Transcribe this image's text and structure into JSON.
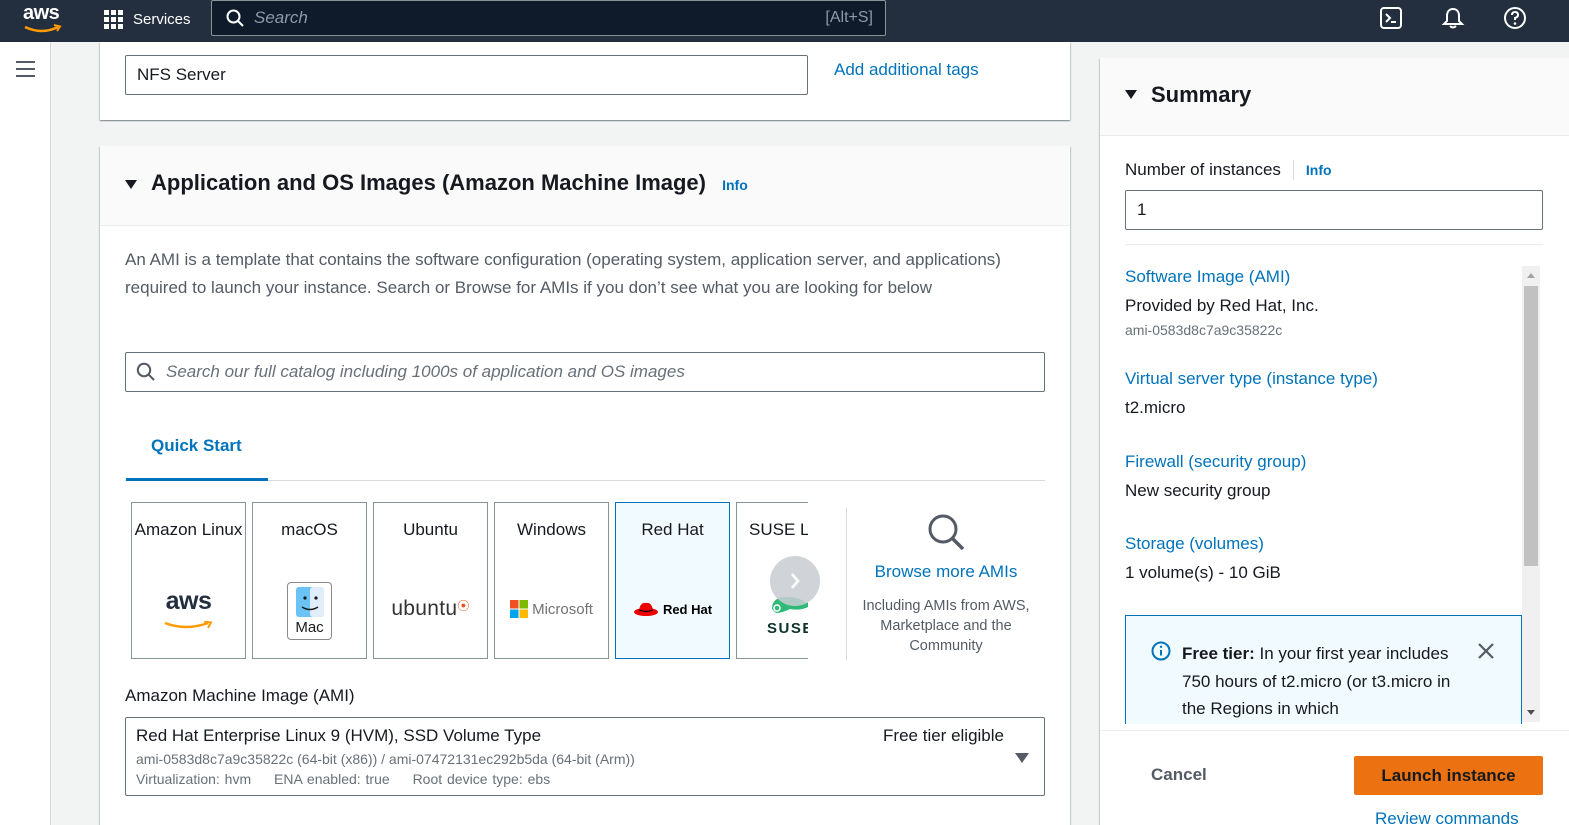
{
  "topnav": {
    "logo_text": "aws",
    "services_label": "Services",
    "search_placeholder": "Search",
    "search_shortcut": "[Alt+S]",
    "icons": [
      "cloudshell-icon",
      "notifications-bell-icon",
      "help-icon"
    ]
  },
  "name_section": {
    "name_value": "NFS Server",
    "add_tags_label": "Add additional tags"
  },
  "ami_section": {
    "title": "Application and OS Images (Amazon Machine Image)",
    "info_label": "Info",
    "description": "An AMI is a template that contains the software configuration (operating system, application server, and applications) required to launch your instance. Search or Browse for AMIs if you don’t see what you are looking for below",
    "catalog_search_placeholder": "Search our full catalog including 1000s of application and OS images",
    "tab_label": "Quick Start",
    "os_cards": [
      {
        "label": "Amazon Linux",
        "logo": "aws"
      },
      {
        "label": "macOS",
        "logo": "Mac"
      },
      {
        "label": "Ubuntu",
        "logo": "ubuntu"
      },
      {
        "label": "Windows",
        "logo": "Microsoft"
      },
      {
        "label": "Red Hat",
        "logo": "Red Hat",
        "selected": true
      },
      {
        "label": "SUSE Li",
        "logo": "SUSE"
      }
    ],
    "browse_title": "Browse more AMIs",
    "browse_subtitle": "Including AMIs from AWS, Marketplace and the Community",
    "ami_label": "Amazon Machine Image (AMI)",
    "ami_selected": {
      "name": "Red Hat Enterprise Linux 9 (HVM), SSD Volume Type",
      "badge": "Free tier eligible",
      "ids": "ami-0583d8c7a9c35822c (64-bit (x86)) / ami-07472131ec292b5da (64-bit (Arm))",
      "virtualization": "Virtualization: hvm",
      "ena": "ENA enabled: true",
      "root_device": "Root device type: ebs"
    }
  },
  "summary": {
    "title": "Summary",
    "num_instances_label": "Number of instances",
    "info_label": "Info",
    "num_instances_value": "1",
    "software_image_label": "Software Image (AMI)",
    "software_image_value": "Provided by Red Hat, Inc.",
    "software_image_id": "ami-0583d8c7a9c35822c",
    "instance_type_label": "Virtual server type (instance type)",
    "instance_type_value": "t2.micro",
    "firewall_label": "Firewall (security group)",
    "firewall_value": "New security group",
    "storage_label": "Storage (volumes)",
    "storage_value": "1 volume(s) - 10 GiB",
    "free_tier_title": "Free tier:",
    "free_tier_text": "In your first year includes 750 hours of t2.micro (or t3.micro in the Regions in which",
    "cancel_label": "Cancel",
    "launch_label": "Launch instance",
    "review_label": "Review commands"
  }
}
